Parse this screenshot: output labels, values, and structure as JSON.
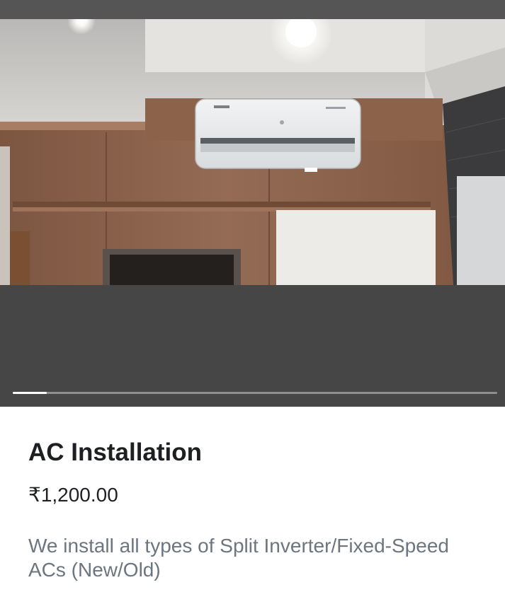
{
  "gallery": {
    "image_alt": "Split AC unit mounted on a wood-paneled wall",
    "slide_progress": 0.07
  },
  "product": {
    "title": "AC Installation",
    "price": "₹1,200.00",
    "description": "We install all types of Split Inverter/Fixed-Speed ACs (New/Old)"
  }
}
